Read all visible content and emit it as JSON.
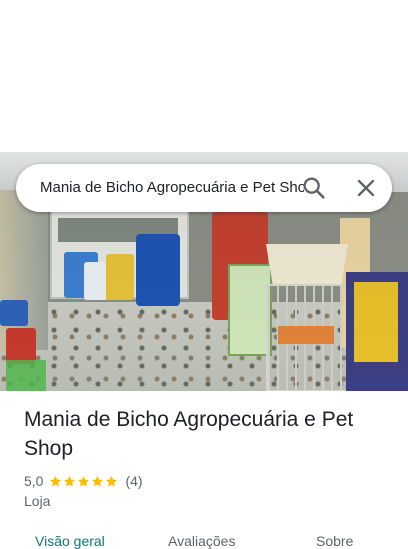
{
  "search": {
    "query": "Mania de Bicho Agropecuária e Pet Shop",
    "search_icon": "search-icon",
    "close_icon": "close-icon"
  },
  "place": {
    "name": "Mania de Bicho Agropecuária e Pet Shop",
    "rating": "5,0",
    "stars": 5,
    "review_count": "(4)",
    "category": "Loja"
  },
  "tabs": [
    {
      "label": "Visão geral",
      "active": true
    },
    {
      "label": "Avaliações",
      "active": false
    },
    {
      "label": "Sobre",
      "active": false
    }
  ],
  "colors": {
    "star": "#fbbc04",
    "active_tab": "#0f766e",
    "secondary_text": "#5f6368"
  }
}
